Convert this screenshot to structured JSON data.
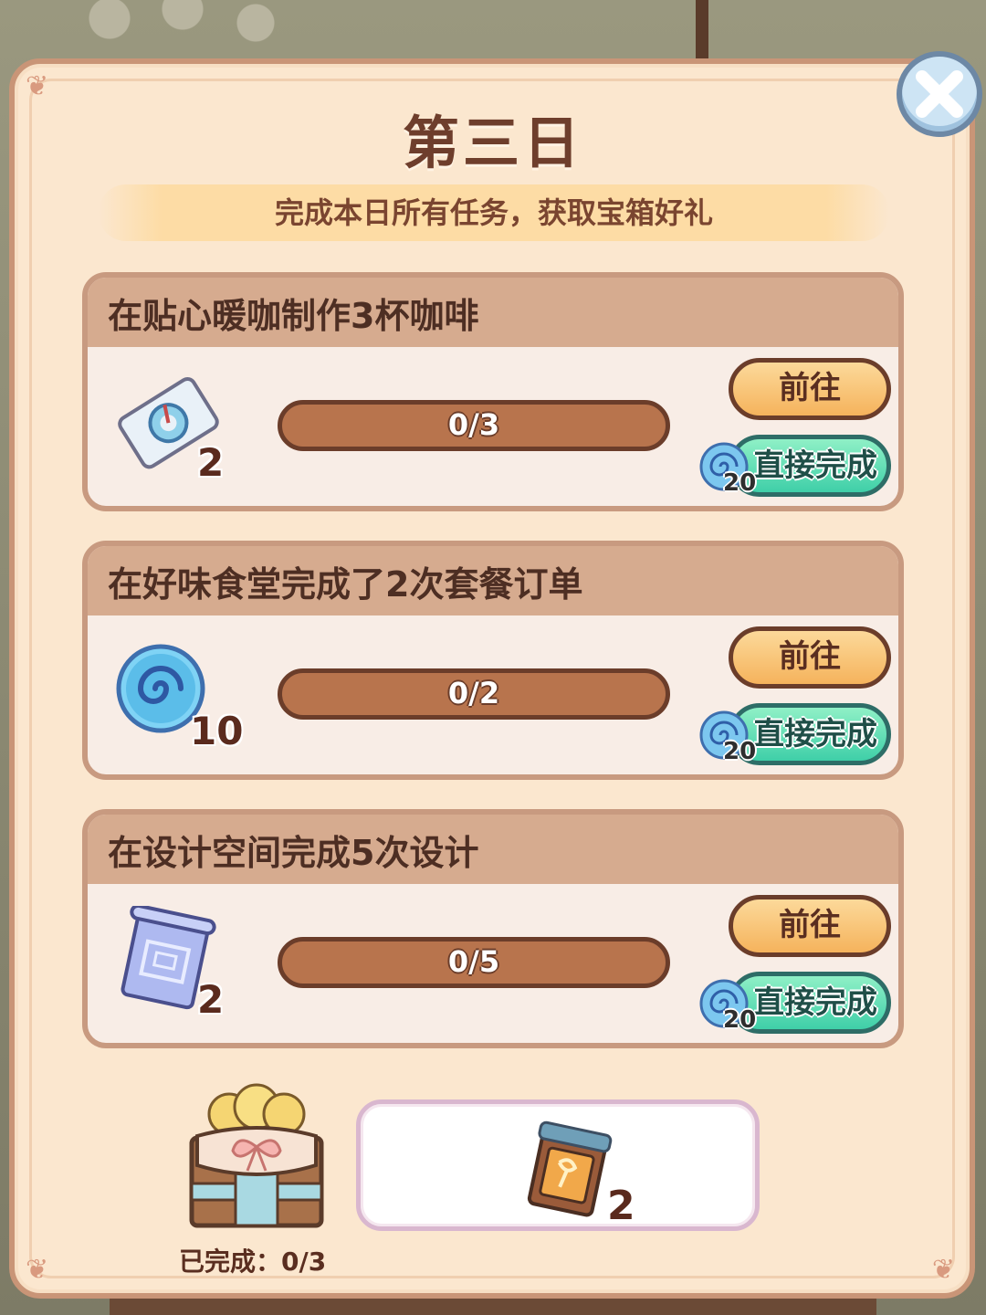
{
  "panel": {
    "title": "第三日",
    "banner": "完成本日所有任务，获取宝箱好礼"
  },
  "tasks": [
    {
      "title": "在贴心暖咖制作3杯咖啡",
      "reward_icon": "coffee-ticket-icon",
      "reward_count": "2",
      "progress_text": "0/3",
      "progress": 0,
      "go_label": "前往",
      "finish_label": "直接完成",
      "cost": "20"
    },
    {
      "title": "在好味食堂完成了2次套餐订单",
      "reward_icon": "blue-swirl-currency-icon",
      "reward_count": "10",
      "progress_text": "0/2",
      "progress": 0,
      "go_label": "前往",
      "finish_label": "直接完成",
      "cost": "20"
    },
    {
      "title": "在设计空间完成5次设计",
      "reward_icon": "blueprint-scroll-icon",
      "reward_count": "2",
      "progress_text": "0/5",
      "progress": 0,
      "go_label": "前往",
      "finish_label": "直接完成",
      "cost": "20"
    }
  ],
  "chest": {
    "completed_text": "已完成：0/3"
  },
  "final_reward": {
    "icon": "treasure-map-card-icon",
    "count": "2"
  },
  "colors": {
    "panel_bg": "#fbe7cf",
    "task_header": "#d6ab8f",
    "go_button": "#f5b35c",
    "finish_button": "#3fcfa8",
    "progress_bar": "#b8744d"
  }
}
